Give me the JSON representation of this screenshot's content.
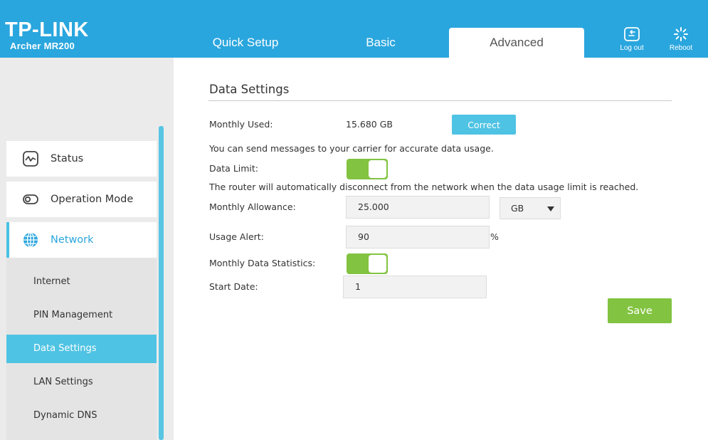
{
  "header": {
    "logo": "TP-LINK",
    "model": "Archer MR200",
    "tabs": [
      {
        "label": "Quick Setup"
      },
      {
        "label": "Basic"
      },
      {
        "label": "Advanced"
      }
    ],
    "logout_label": "Log out",
    "reboot_label": "Reboot",
    "bg_color": "#2aa6de"
  },
  "sidebar": {
    "main_items": [
      {
        "label": "Status",
        "icon": "status-icon"
      },
      {
        "label": "Operation Mode",
        "icon": "operation-mode-icon"
      },
      {
        "label": "Network",
        "icon": "network-globe-icon"
      }
    ],
    "sub_items": [
      {
        "label": "Internet"
      },
      {
        "label": "PIN Management"
      },
      {
        "label": "Data Settings"
      },
      {
        "label": "LAN Settings"
      },
      {
        "label": "Dynamic DNS"
      }
    ]
  },
  "content": {
    "title": "Data Settings",
    "monthly_used_label": "Monthly Used:",
    "monthly_used_value": "15.680 GB",
    "correct_button": "Correct",
    "carrier_note": "You can send messages to your carrier for accurate data usage.",
    "data_limit_label": "Data Limit:",
    "data_limit_on": true,
    "disconnect_note": "The router will automatically disconnect from the network when the data usage limit is reached.",
    "monthly_allowance_label": "Monthly Allowance:",
    "monthly_allowance_value": "25.000",
    "unit_selected": "GB",
    "usage_alert_label": "Usage Alert:",
    "usage_alert_value": "90",
    "usage_alert_unit": "%",
    "monthly_stats_label": "Monthly Data Statistics:",
    "monthly_stats_on": true,
    "start_date_label": "Start Date:",
    "start_date_value": "1",
    "save_button": "Save"
  },
  "colors": {
    "accent": "#4fc3e3",
    "toggle_on": "#82c341",
    "save": "#82c341"
  }
}
